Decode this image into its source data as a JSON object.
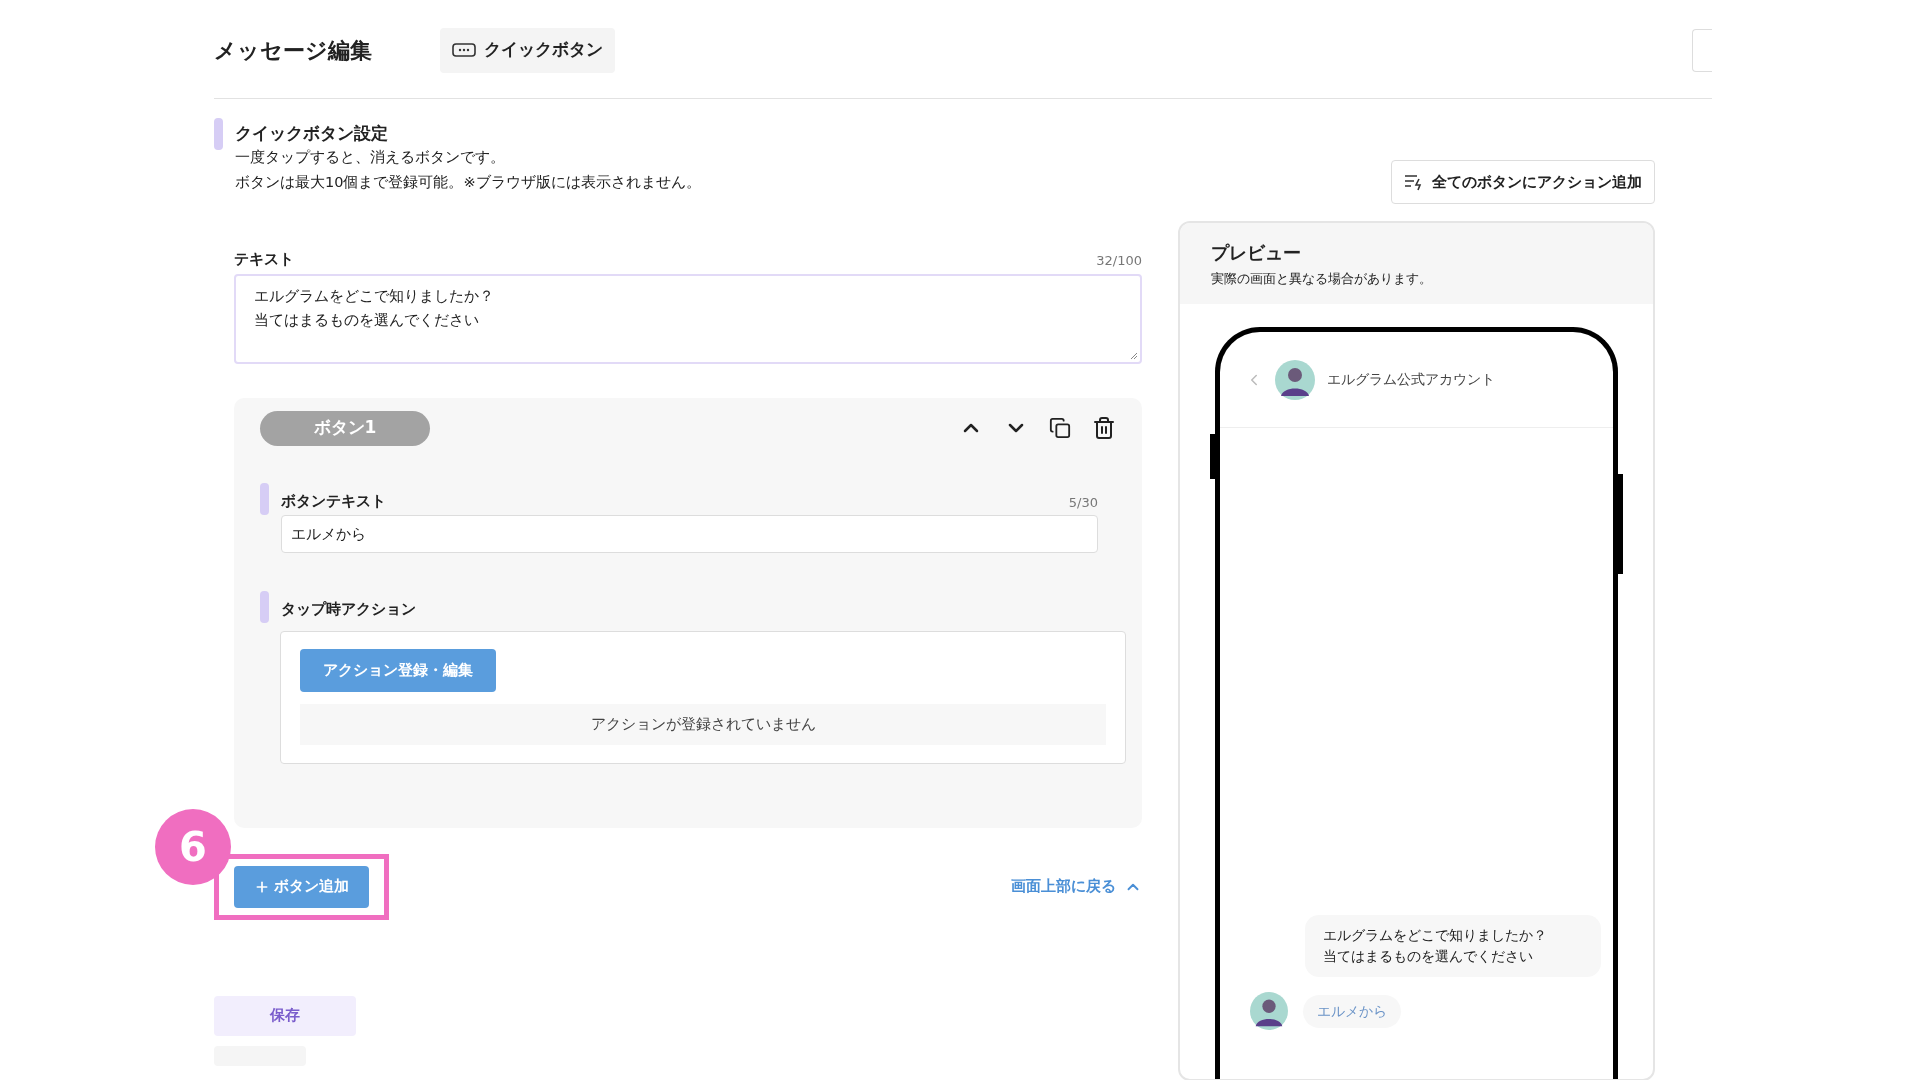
{
  "header": {
    "title": "メッセージ編集",
    "tab": "クイックボタン"
  },
  "section": {
    "title": "クイックボタン設定",
    "description": [
      "一度タップすると、消えるボタンです。",
      "ボタンは最大10個まで登録可能。※ブラウザ版には表示されません。"
    ],
    "action_all_button": "全てのボタンにアクション追加"
  },
  "text_field": {
    "label": "テキスト",
    "counter": "32/100",
    "value_lines": [
      "エルグラムをどこで知りましたか？",
      "当てはまるものを選んでください"
    ]
  },
  "buttons": [
    {
      "badge": "ボタン1",
      "text_label": "ボタンテキスト",
      "text_counter": "5/30",
      "text_value": "エルメから",
      "action_label": "タップ時アクション",
      "action_button": "アクション登録・編集",
      "action_empty": "アクションが登録されていません"
    }
  ],
  "annotation": {
    "number": "6"
  },
  "add_button": "ボタン追加",
  "back_to_top": "画面上部に戻る",
  "save_button": "保存",
  "preview": {
    "title": "プレビュー",
    "note": "実際の画面と異なる場合があります。",
    "account_name": "エルグラム公式アカウント",
    "message_lines": [
      "エルグラムをどこで知りましたか？",
      "当てはまるものを選んでください"
    ],
    "quick_replies": [
      "エルメから"
    ]
  }
}
